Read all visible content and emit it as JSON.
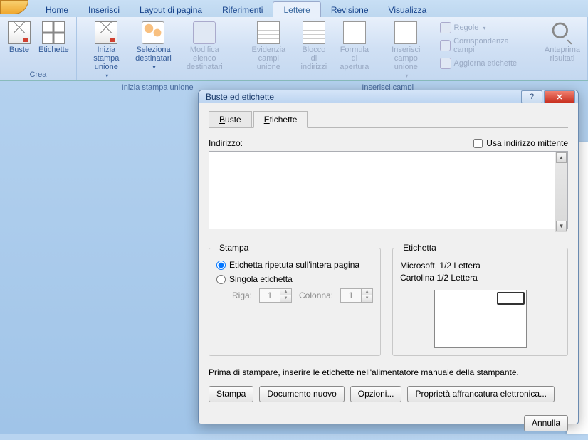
{
  "tabs": {
    "home": "Home",
    "inserisci": "Inserisci",
    "layout": "Layout di pagina",
    "riferimenti": "Riferimenti",
    "lettere": "Lettere",
    "revisione": "Revisione",
    "visualizza": "Visualizza"
  },
  "ribbon": {
    "crea": {
      "label": "Crea",
      "buste": "Buste",
      "etichette": "Etichette"
    },
    "inizia": {
      "label": "Inizia stampa unione",
      "inizia_btn": "Inizia stampa\nunione",
      "seleziona": "Seleziona\ndestinatari",
      "modifica": "Modifica elenco\ndestinatari"
    },
    "campi": {
      "label": "Inserisci campi",
      "evidenzia": "Evidenzia\ncampi unione",
      "blocco": "Blocco di\nindirizzi",
      "formula": "Formula di\napertura",
      "inserisci": "Inserisci campo\nunione",
      "regole": "Regole",
      "corrispondenza": "Corrispondenza campi",
      "aggiorna": "Aggiorna etichette"
    },
    "anteprima": {
      "btn": "Anteprima\nrisultati"
    }
  },
  "dialog": {
    "title": "Buste ed etichette",
    "tabs": {
      "buste": "Buste",
      "etichette": "Etichette",
      "buste_u": "B",
      "etichette_u": "E"
    },
    "indirizzo_label": "Indirizzo:",
    "usa_mittente": "Usa indirizzo mittente",
    "usa_mittente_u": "U",
    "addr_value": "",
    "stampa": {
      "legend": "Stampa",
      "ripetuta": "Etichetta ripetuta sull'intera pagina",
      "singola": "Singola etichetta",
      "singola_u": "h",
      "riga": "Riga:",
      "riga_val": "1",
      "colonna": "Colonna:",
      "colonna_val": "1"
    },
    "etichetta": {
      "legend": "Etichetta",
      "line1": "Microsoft, 1/2 Lettera",
      "line2": "Cartolina 1/2 Lettera"
    },
    "hint": "Prima di stampare, inserire le etichette nell'alimentatore manuale della stampante.",
    "buttons": {
      "stampa": "Stampa",
      "documento": "Documento nuovo",
      "opzioni": "Opzioni...",
      "proprieta": "Proprietà affrancatura elettronica...",
      "annulla": "Annulla"
    }
  }
}
